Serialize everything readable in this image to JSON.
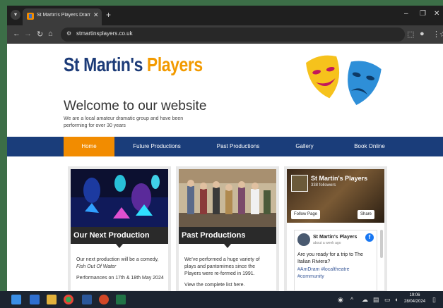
{
  "browser": {
    "tab_title": "St Martin's Players Drama Grou",
    "url": "stmartinsplayers.co.uk"
  },
  "site": {
    "logo_part1": "St Martin's ",
    "logo_part2": "Players",
    "welcome": "Welcome to our website",
    "subtitle": "We are a local amateur dramatic group and have been performing for over 30 years",
    "nav": [
      "Home",
      "Future Productions",
      "Past Productions",
      "Gallery",
      "Book Online"
    ],
    "cards": [
      {
        "title": "Our Next Production",
        "p1": "Our next production will be a comedy, ",
        "p1_italic": "Fish Out Of Water",
        "p2": "Performances on 17th & 18th May 2024"
      },
      {
        "title": "Past Productions",
        "p1": "We've performed a huge variety of plays and pantomimes since the Players were re-formed in 1991.",
        "p2": "View the complete list here."
      }
    ],
    "facebook": {
      "page_name": "St Martin's Players",
      "followers": "338 followers",
      "follow_btn": "Follow Page",
      "share_btn": "Share",
      "post_name": "St Martin's Players",
      "post_time": "about a week ago",
      "post_text": "Are you ready for a trip to The Italian Riviera?",
      "hashtags1": "#AmDram #localtheatre",
      "hashtags2": "#community"
    }
  },
  "taskbar": {
    "time": "19:06",
    "date": "28/04/2024"
  },
  "colors": {
    "brand_blue": "#1c3b78",
    "brand_orange": "#f29a00",
    "nav_bg": "#1a3d7a"
  }
}
